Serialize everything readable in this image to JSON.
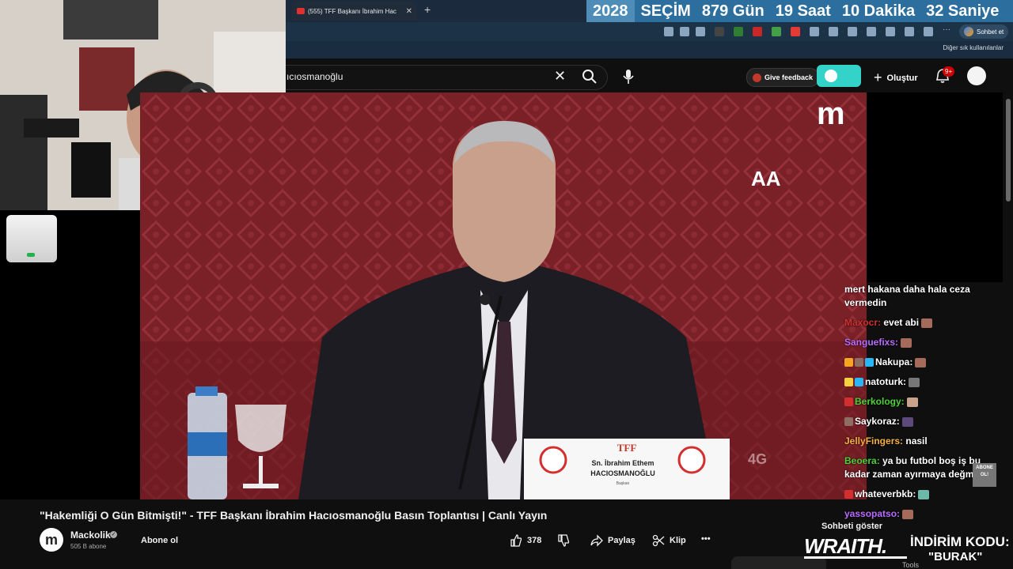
{
  "browser": {
    "tab_title": "(555) TFF Başkanı İbrahim Hac",
    "new_tab_symbol": "+",
    "countdown": {
      "year": "2028",
      "label": "SEÇİM",
      "days": "879 Gün",
      "hours": "19 Saat",
      "minutes": "10 Dakika",
      "seconds": "32 Saniye"
    },
    "copilot_label": "Sohbet et",
    "bookmarks_other": "Diğer sık kullanılanlar"
  },
  "youtube": {
    "search_value": "ıcıosmanoğlu",
    "feedback_label": "Give feedback",
    "create_label": "Oluştur",
    "notif_count": "9+"
  },
  "video": {
    "title": "\"Hakemliği O Gün Bitmişti!\" - TFF Başkanı İbrahim Hacıosmanoğlu Basın Toplantısı | Canlı Yayın",
    "nameplate_org": "TFF",
    "nameplate_name1": "Sn. İbrahim Ethem",
    "nameplate_name2": "HACIOSMANOĞLU",
    "nameplate_role": "Başkan",
    "watermark_4g": "4G",
    "logo_aa": "AA",
    "logo_m": "m"
  },
  "channel": {
    "name": "Mackolik",
    "subs": "505 B abone",
    "logo_letter": "m",
    "subscribe_label": "Abone ol"
  },
  "actions": {
    "likes": "378",
    "share": "Paylaş",
    "clip": "Klip",
    "more": "•••"
  },
  "chat": {
    "messages": [
      {
        "user": "",
        "text": "mert hakana daha hala ceza vermedin",
        "color": "#ffffff"
      },
      {
        "user": "Maxocr:",
        "text": "evet abi",
        "color": "#d0322e"
      },
      {
        "user": "Sanguefixs:",
        "text": "",
        "color": "#b86cff"
      },
      {
        "user": "Nakupa:",
        "text": "",
        "color": "#ffffff"
      },
      {
        "user": "natoturk:",
        "text": "",
        "color": "#ffffff"
      },
      {
        "user": "Berkology:",
        "text": "",
        "color": "#4cd137"
      },
      {
        "user": "Saykoraz:",
        "text": "",
        "color": "#ffffff"
      },
      {
        "user": "JellyFingers:",
        "text": "nasil",
        "color": "#f5b041"
      },
      {
        "user": "Beoera:",
        "text": "ya bu futbol boş iş bu kadar zaman ayırmaya değmez",
        "color": "#4cd137"
      },
      {
        "user": "whateverbkb:",
        "text": "",
        "color": "#ffffff"
      },
      {
        "user": "yassopatso:",
        "text": "",
        "color": "#b86cff"
      }
    ],
    "abone_overlay": "ABONE OL!",
    "show_chat": "Sohbeti göster"
  },
  "ads": {
    "brand": "WRAITH.",
    "promo": "İNDİRİM KODU:",
    "code": "\"BURAK\""
  },
  "bottom": {
    "tools": "Tools"
  }
}
